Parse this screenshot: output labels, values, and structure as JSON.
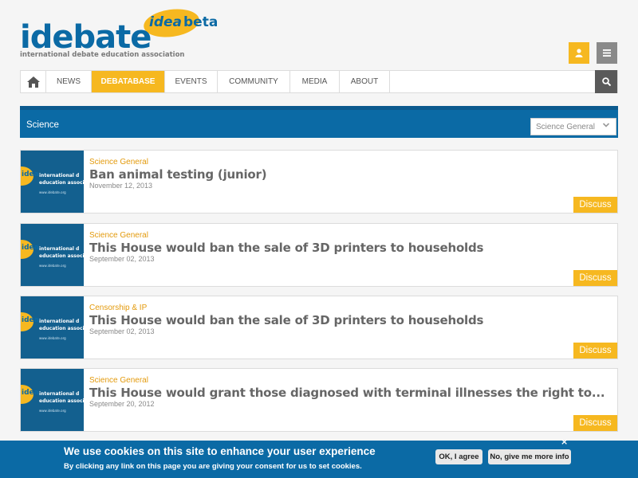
{
  "header": {
    "logo_word": "idebate",
    "logo_bubble": "idea",
    "logo_beta": "beta",
    "logo_tagline": "international debate education association",
    "user_icon": "user-icon",
    "menu_icon": "menu-icon"
  },
  "nav": {
    "home_icon": "home-icon",
    "items": [
      {
        "label": "NEWS"
      },
      {
        "label": "DEBATABASE"
      },
      {
        "label": "EVENTS"
      },
      {
        "label": "COMMUNITY"
      },
      {
        "label": "MEDIA"
      },
      {
        "label": "ABOUT"
      }
    ],
    "active_index": 1,
    "search_icon": "search-icon"
  },
  "section": {
    "title": "Science",
    "filter_value": "Science General"
  },
  "thumb": {
    "bubble": "idea",
    "line1": "international d",
    "line2": "education associ",
    "url": "www.idebate.org"
  },
  "items": [
    {
      "category": "Science General",
      "title": "Ban animal testing (junior)",
      "date": "November 12, 2013",
      "action": "Discuss"
    },
    {
      "category": "Science General",
      "title": "This House would ban the sale of 3D printers to households",
      "date": "September 02, 2013",
      "action": "Discuss"
    },
    {
      "category": "Censorship & IP",
      "title": "This House would ban the sale of 3D printers to households",
      "date": "September 02, 2013",
      "action": "Discuss"
    },
    {
      "category": "Science General",
      "title": "This House would grant those diagnosed with terminal illnesses the right to...",
      "date": "September 20, 2012",
      "action": "Discuss"
    }
  ],
  "cookie": {
    "heading": "We use cookies on this site to enhance your user experience",
    "text": "By clicking any link on this page you are giving your consent for us to set cookies.",
    "ok_label": "OK, I agree",
    "more_label": "No, give me more info",
    "close_glyph": "×"
  },
  "colors": {
    "brand_blue": "#0b6aa5",
    "accent_yellow": "#f6b820"
  }
}
